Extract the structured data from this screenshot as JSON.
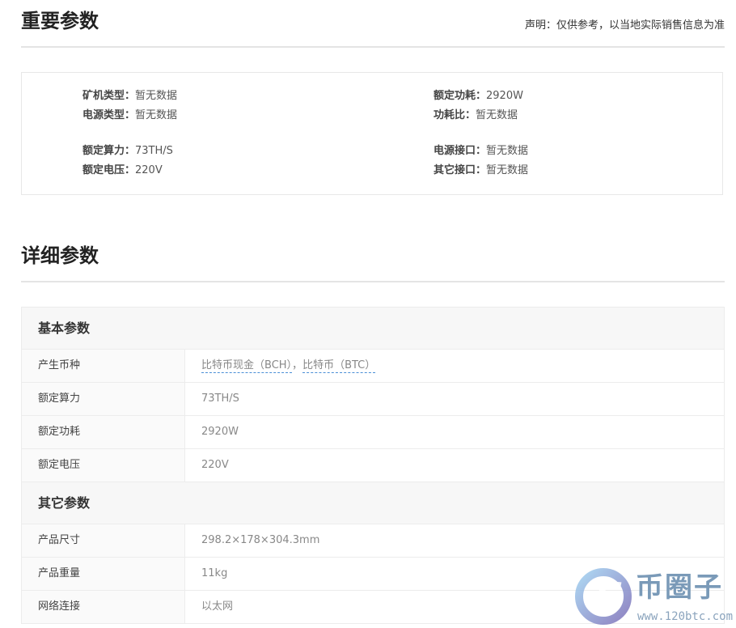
{
  "key_params": {
    "title": "重要参数",
    "disclaimer": "声明：仅供参考，以当地实际销售信息为准",
    "items": [
      {
        "label": "矿机类型：",
        "value": "暂无数据"
      },
      {
        "label": "电源类型：",
        "value": "暂无数据"
      },
      {
        "label": "额定算力：",
        "value": "73TH/S"
      },
      {
        "label": "额定电压：",
        "value": "220V"
      },
      {
        "label": "额定功耗：",
        "value": "2920W"
      },
      {
        "label": "功耗比：",
        "value": "暂无数据"
      },
      {
        "label": "电源接口：",
        "value": "暂无数据"
      },
      {
        "label": "其它接口：",
        "value": "暂无数据"
      }
    ]
  },
  "detail_params": {
    "title": "详细参数",
    "groups": [
      {
        "title": "基本参数",
        "rows": [
          {
            "label": "产生币种",
            "coins": [
              "比特币现金（BCH）",
              "比特币（BTC）"
            ],
            "separator": "，"
          },
          {
            "label": "额定算力",
            "value": "73TH/S"
          },
          {
            "label": "额定功耗",
            "value": "2920W"
          },
          {
            "label": "额定电压",
            "value": "220V"
          }
        ]
      },
      {
        "title": "其它参数",
        "rows": [
          {
            "label": "产品尺寸",
            "value": "298.2×178×304.3mm"
          },
          {
            "label": "产品重量",
            "value": "11kg"
          },
          {
            "label": "网络连接",
            "value": "以太网"
          }
        ]
      }
    ]
  },
  "watermark": {
    "brand": "币圈子",
    "url": "www.120btc.com",
    "colors": {
      "ring_light": "#9fd0f0",
      "ring_dark": "#7c6fb8",
      "text": "#7a9ab8"
    }
  }
}
